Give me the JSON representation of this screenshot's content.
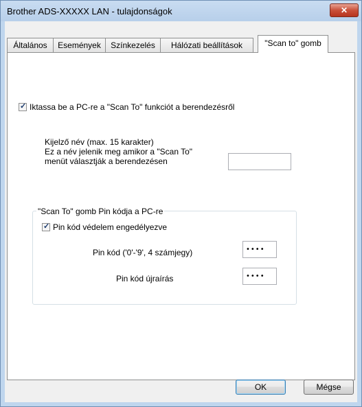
{
  "window": {
    "title": "Brother ADS-XXXXX LAN - tulajdonságok",
    "close_label": "✕"
  },
  "tabs": [
    {
      "label": "Általános"
    },
    {
      "label": "Események"
    },
    {
      "label": "Színkezelés"
    },
    {
      "label": "Hálózati beállítások"
    },
    {
      "label": "\"Scan to\" gomb"
    }
  ],
  "active_tab": "\"Scan to\" gomb",
  "panel": {
    "register_checkbox": {
      "label": "Iktassa be a PC-re a \"Scan To\" funkciót a berendezésről",
      "checked": true
    },
    "display_name": {
      "line1": "Kijelző név (max. 15 karakter)",
      "line2": "Ez a név jelenik meg amikor a \"Scan To\"",
      "line3": "menüt választják a berendezésen",
      "value": ""
    },
    "pin_group": {
      "legend": "\"Scan To\" gomb Pin kódja a PC-re",
      "enable_checkbox": {
        "label": "Pin kód védelem engedélyezve",
        "checked": true
      },
      "pin_label": "Pin kód ('0'-'9', 4 számjegy)",
      "pin_value": "••••",
      "pin_retype_label": "Pin kód újraírás",
      "pin_retype_value": "••••"
    }
  },
  "buttons": {
    "ok": "OK",
    "cancel": "Mégse"
  }
}
